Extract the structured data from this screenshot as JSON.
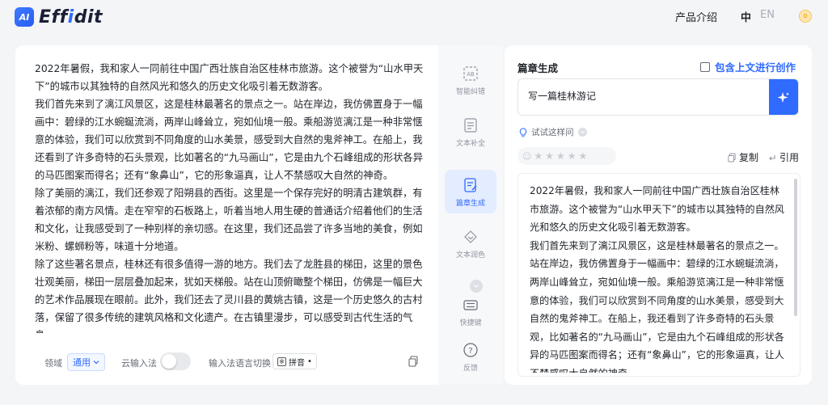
{
  "header": {
    "logo_badge": "AI",
    "logo_prefix": "Eff",
    "logo_accent": "i",
    "logo_suffix": "dit",
    "nav_product": "产品介绍",
    "lang_zh": "中",
    "lang_en": "EN",
    "user_initial": "o"
  },
  "editor": {
    "paragraphs": [
      "2022年暑假，我和家人一同前往中国广西壮族自治区桂林市旅游。这个被誉为“山水甲天下”的城市以其独特的自然风光和悠久的历史文化吸引着无数游客。",
      "我们首先来到了漓江风景区，这是桂林最著名的景点之一。站在岸边，我仿佛置身于一幅画中：碧绿的江水蜿蜒流淌，两岸山峰耸立，宛如仙境一般。乘船游览漓江是一种非常惬意的体验，我们可以欣赏到不同角度的山水美景，感受到大自然的鬼斧神工。在船上，我还看到了许多奇特的石头景观，比如著名的“九马画山”，它是由九个石峰组成的形状各异的马匹图案而得名；还有“象鼻山”，它的形象逼真，让人不禁感叹大自然的神奇。",
      "除了美丽的漓江，我们还参观了阳朔县的西街。这里是一个保存完好的明清古建筑群，有着浓郁的南方风情。走在窄窄的石板路上，听着当地人用生硬的普通话介绍着他们的生活和文化，让我感受到了一种别样的亲切感。在这里，我们还品尝了许多当地的美食，例如米粉、螺蛳粉等，味道十分地道。",
      "除了这些著名景点，桂林还有很多值得一游的地方。我们去了龙胜县的梯田，这里的景色壮观美丽，梯田一层层叠加起来，犹如天梯般。站在山顶俯瞰整个梯田，仿佛是一幅巨大的艺术作品展现在眼前。此外，我们还去了灵川县的黄姚古镇，这是一个历史悠久的古村落，保留了很多传统的建筑风格和文化遗产。在古镇里漫步，可以感受到古代生活的气息。"
    ],
    "domain_label": "领域",
    "domain_value": "通用",
    "cloud_ime_label": "云输入法",
    "ime_switch_label": "输入法语言切换",
    "ime_value": "拼音"
  },
  "tools": [
    {
      "label": "智能纠错",
      "icon": "ab-check-icon"
    },
    {
      "label": "文本补全",
      "icon": "doc-complete-icon"
    },
    {
      "label": "篇章生成",
      "icon": "doc-generate-icon"
    },
    {
      "label": "文本润色",
      "icon": "diamond-icon"
    },
    {
      "label": "快捷键",
      "icon": "keyboard-icon"
    },
    {
      "label": "反馈",
      "icon": "question-icon"
    }
  ],
  "right": {
    "title": "篇章生成",
    "context_check_label": "包含上文进行创作",
    "prompt_value": "写一篇桂林游记",
    "try_label": "试试这样问",
    "copy_label": "复制",
    "quote_label": "引用",
    "result_paragraphs": [
      "2022年暑假，我和家人一同前往中国广西壮族自治区桂林市旅游。这个被誉为“山水甲天下”的城市以其独特的自然风光和悠久的历史文化吸引着无数游客。",
      "我们首先来到了漓江风景区，这是桂林最著名的景点之一。站在岸边，我仿佛置身于一幅画中：碧绿的江水蜿蜒流淌，两岸山峰耸立，宛如仙境一般。乘船游览漓江是一种非常惬意的体验，我们可以欣赏到不同角度的山水美景，感受到大自然的鬼斧神工。在船上，我还看到了许多奇特的石头景观，比如著名的“九马画山”，它是由九个石峰组成的形状各异的马匹图案而得名；还有“象鼻山”，它的形象逼真，让人不禁感叹大自然的神奇。"
    ],
    "rating": 0,
    "rating_max": 5
  },
  "colors": {
    "accent": "#2f6bff",
    "panel_bg": "#ffffff",
    "page_bg": "#f4f5f7"
  }
}
